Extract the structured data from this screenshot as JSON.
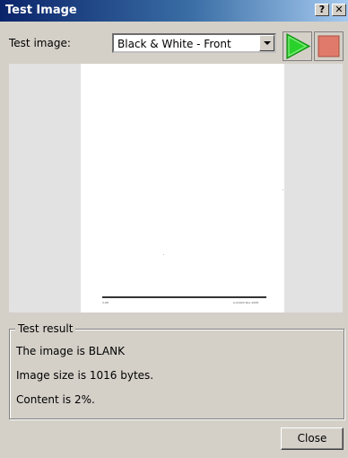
{
  "window": {
    "title": "Test Image",
    "help_label": "?",
    "close_label": "✕"
  },
  "controls": {
    "test_image_label": "Test image:",
    "selected_option": "Black & White - Front",
    "play_icon": "play-icon",
    "stop_icon": "stop-icon",
    "play_color": "#2bd12b",
    "stop_color": "#e07a6a"
  },
  "preview": {
    "footer_left": "3-08",
    "footer_right": "A-01024  Nov 2008"
  },
  "result": {
    "group_title": "Test result",
    "line1": "The image is BLANK",
    "line2": "Image size is 1016 bytes.",
    "line3": "Content is 2%."
  },
  "footer": {
    "close_button": "Close"
  }
}
